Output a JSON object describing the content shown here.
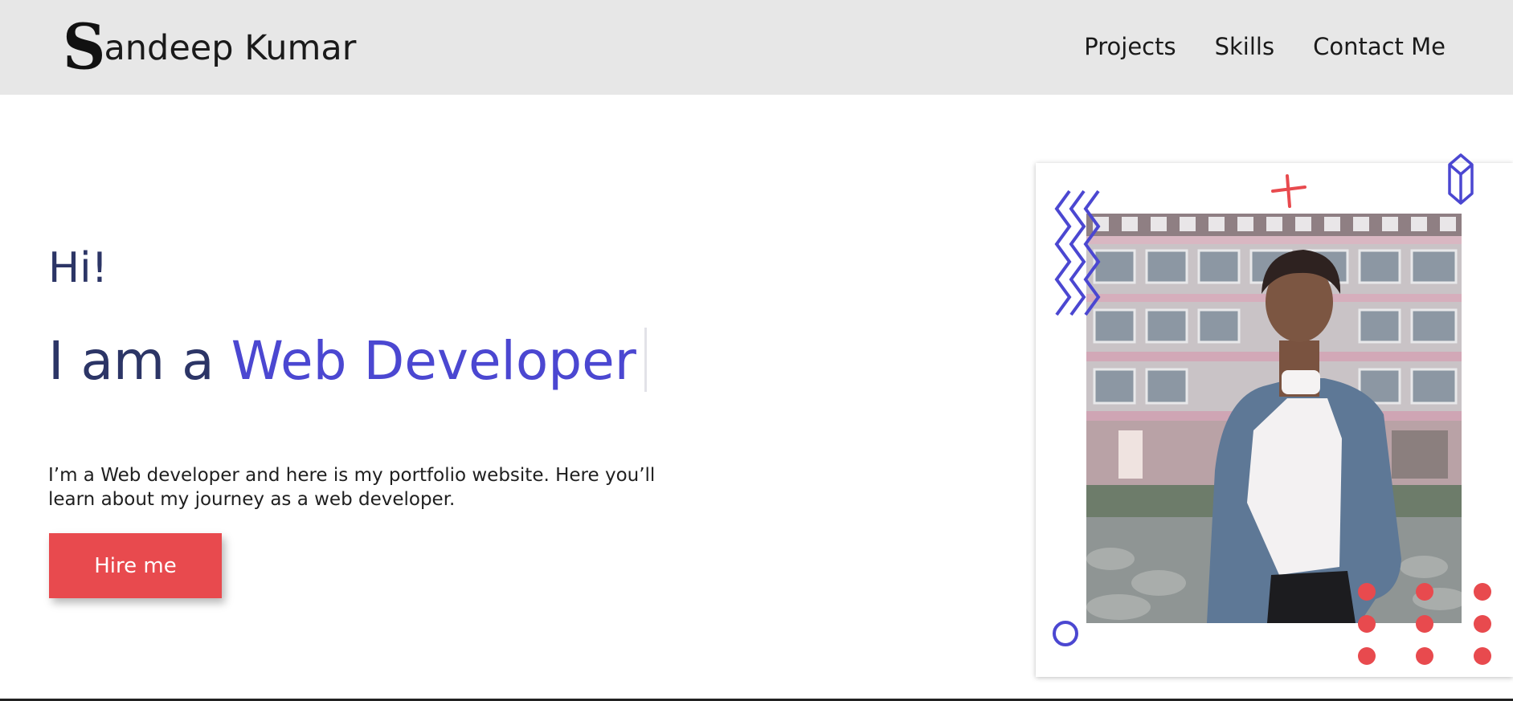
{
  "header": {
    "brand": {
      "initial": "S",
      "rest": "andeep Kumar"
    },
    "nav": [
      {
        "label": "Projects"
      },
      {
        "label": "Skills"
      },
      {
        "label": "Contact Me"
      }
    ]
  },
  "hero": {
    "greeting": "Hi!",
    "headline_prefix": "I am a ",
    "headline_role": "Web Developer",
    "intro": "I’m a Web developer and here is my portfolio website. Here you’ll learn about my journey as a web developer.",
    "cta_label": "Hire me"
  },
  "photo": {
    "decorations": [
      "zigzag-icon",
      "plus-icon",
      "crystal-icon",
      "ring-icon",
      "dot-grid-icon"
    ]
  },
  "colors": {
    "accent": "#4b47d1",
    "heading": "#2c3566",
    "cta": "#e84a4e",
    "header_bg": "#e7e7e7"
  }
}
